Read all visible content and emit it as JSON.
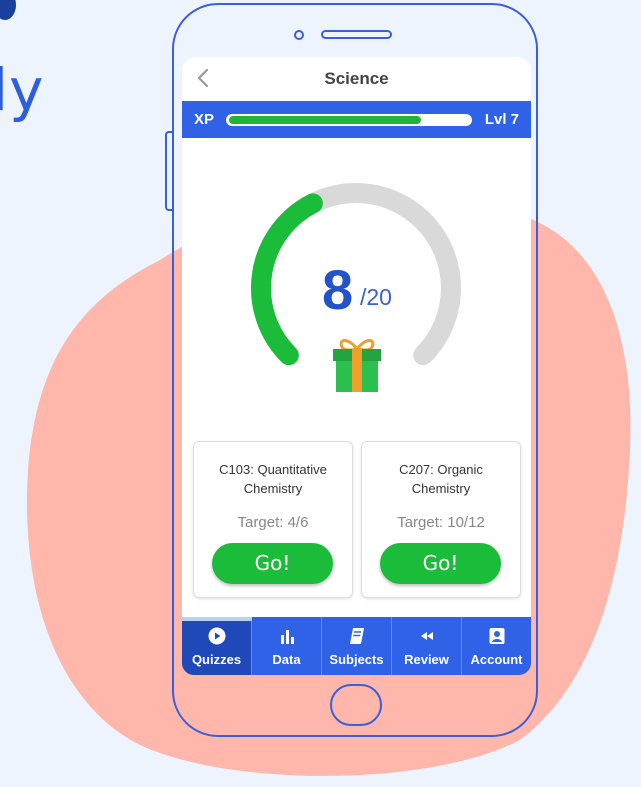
{
  "background": {
    "partial_heading": "ly",
    "colors": {
      "page": "#eef4fd",
      "blob": "#ffb7ab",
      "phone_outline": "#3a5fd9"
    }
  },
  "header": {
    "title": "Science",
    "back_icon": "chevron-left-icon"
  },
  "xp": {
    "label": "XP",
    "level": "Lvl 7",
    "progress": 0.8
  },
  "score": {
    "value": "8",
    "total": "/20",
    "progress": 0.4
  },
  "reward_icon": "gift-icon",
  "cards": [
    {
      "title_line1": "C103: Quantitative",
      "title_line2": "Chemistry",
      "target": "Target: 4/6",
      "button": "Go!"
    },
    {
      "title_line1": "C207: Organic",
      "title_line2": "Chemistry",
      "target": "Target: 10/12",
      "button": "Go!"
    }
  ],
  "tabs": [
    {
      "label": "Quizzes",
      "icon": "play-icon",
      "active": true
    },
    {
      "label": "Data",
      "icon": "bar-chart-icon",
      "active": false
    },
    {
      "label": "Subjects",
      "icon": "book-icon",
      "active": false
    },
    {
      "label": "Review",
      "icon": "rewind-icon",
      "active": false
    },
    {
      "label": "Account",
      "icon": "account-icon",
      "active": false
    }
  ],
  "colors": {
    "accent": "#2f62e6",
    "success": "#1cbc3b",
    "gauge_track": "#d9d9d9"
  }
}
